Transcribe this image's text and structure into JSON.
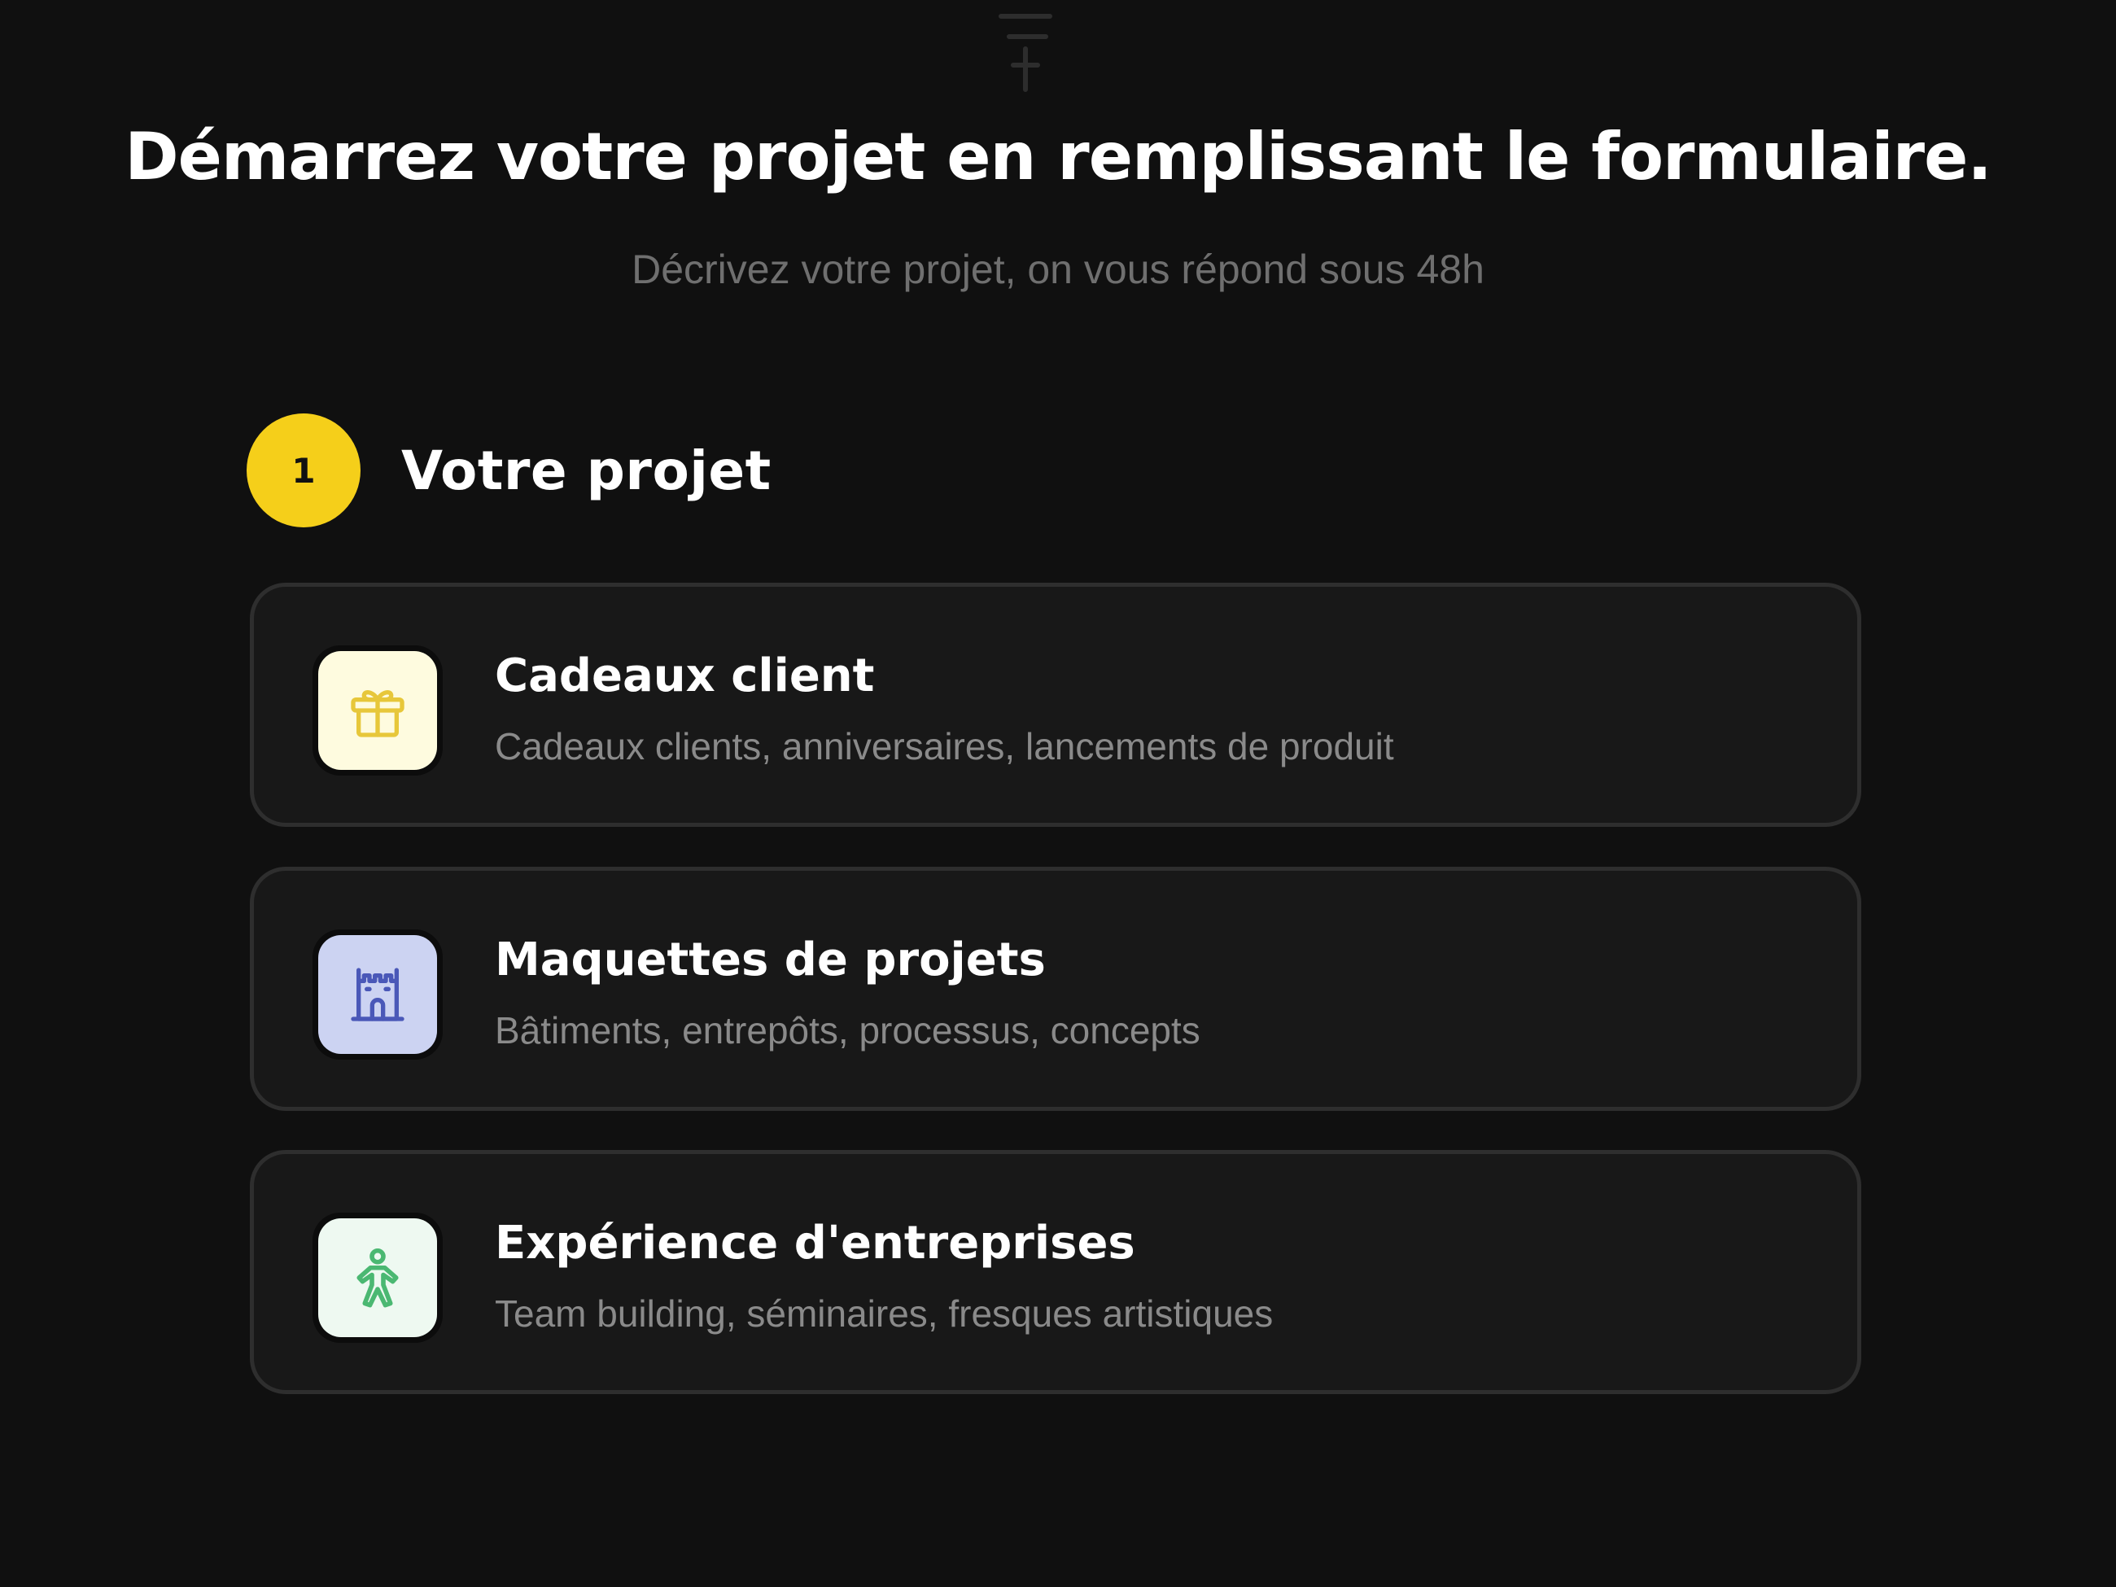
{
  "header": {
    "title": "Démarrez votre projet en remplissant le formulaire.",
    "subtitle": "Décrivez votre projet, on vous répond sous 48h"
  },
  "step": {
    "number": "1",
    "title": "Votre projet"
  },
  "options": [
    {
      "title": "Cadeaux client",
      "description": "Cadeaux clients, anniversaires, lancements de produit",
      "icon": "gift-icon",
      "icon_color": "#e7c73a",
      "tile_color": "#fefbdf"
    },
    {
      "title": "Maquettes de projets",
      "description": "Bâtiments, entrepôts, processus, concepts",
      "icon": "castle-icon",
      "icon_color": "#4a58b8",
      "tile_color": "#ccd3f2"
    },
    {
      "title": "Expérience d'entreprises",
      "description": "Team building, séminaires, fresques artistiques",
      "icon": "person-icon",
      "icon_color": "#4bb872",
      "tile_color": "#eef9f1"
    }
  ],
  "colors": {
    "background": "#101010",
    "accent": "#f5cf1a",
    "card_border": "#2e2e2e",
    "card_background": "#181818"
  }
}
